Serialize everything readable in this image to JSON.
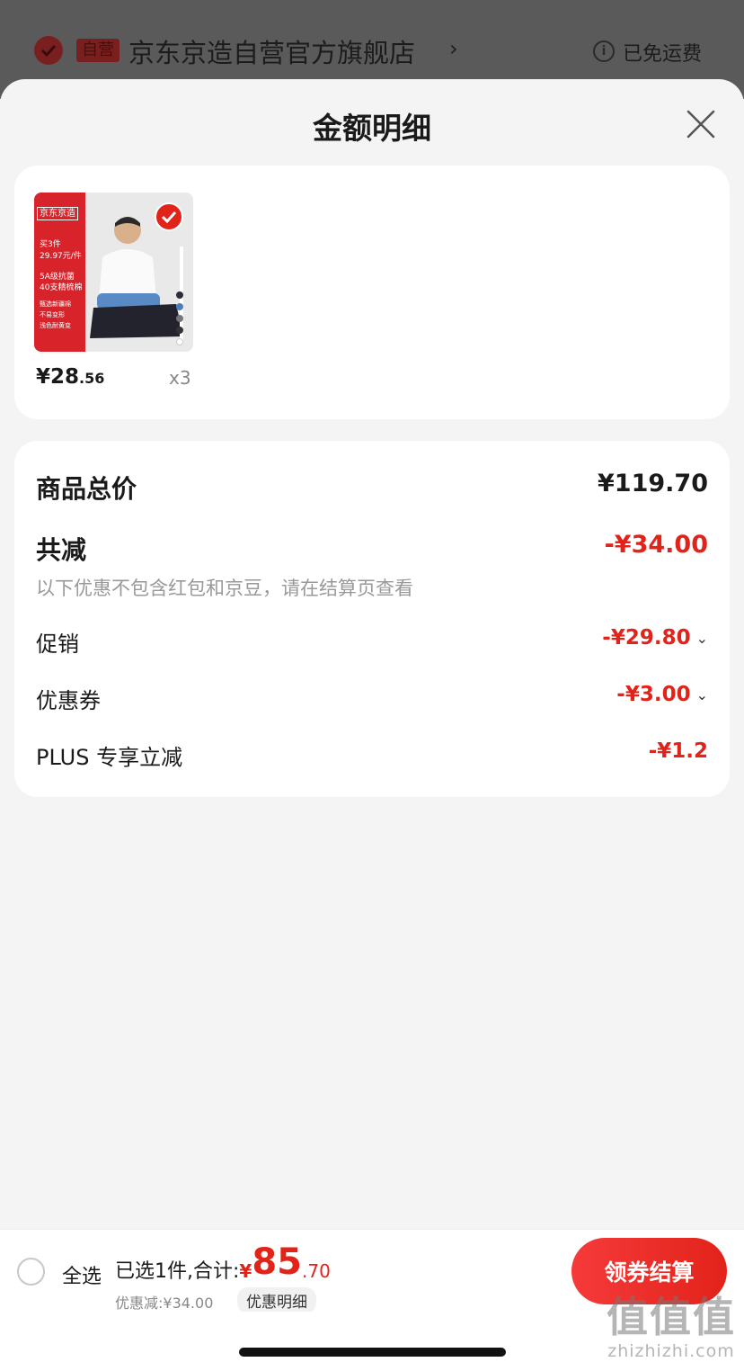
{
  "store": {
    "self_operated_tag": "自营",
    "name": "京东京造自营官方旗舰店",
    "chevron": "›",
    "shipping": "已免运费",
    "info_icon_glyph": "i"
  },
  "sheet": {
    "title": "金额明细"
  },
  "product": {
    "thumb_brand": "京东京造",
    "thumb_lines": [
      "买3件",
      "29.97元/件",
      "5A级抗菌",
      "40支精梳棉",
      "甄选新疆棉",
      "不易变形",
      "浅色耐黄变"
    ],
    "price_int": "¥28",
    "price_dec": ".56",
    "quantity": "x3",
    "swatch_colors": [
      "#2c2c3a",
      "#4a7fb8",
      "#777777",
      "#333333",
      "#ffffff"
    ]
  },
  "breakdown": {
    "total_label": "商品总价",
    "total_value": "¥119.70",
    "reduce_label": "共减",
    "reduce_value": "-¥34.00",
    "note": "以下优惠不包含红包和京豆，请在结算页查看",
    "promo_label": "促销",
    "promo_value": "-¥29.80",
    "coupon_label": "优惠券",
    "coupon_value": "-¥3.00",
    "plus_label": "PLUS 专享立减",
    "plus_value": "-¥1.2",
    "chevron": "⌄"
  },
  "bottom": {
    "select_all": "全选",
    "summary_prefix": "已选1件,合计:",
    "sum_yen": "¥",
    "sum_int": "85",
    "sum_dec": ".70",
    "discount": "优惠减:¥34.00",
    "detail_tag": "优惠明细",
    "checkout": "领券结算"
  },
  "watermark": {
    "big": "值值值",
    "small": "zhizhizhi.com"
  },
  "colors": {
    "accent_red": "#e2231a",
    "muted_text": "#999999"
  }
}
